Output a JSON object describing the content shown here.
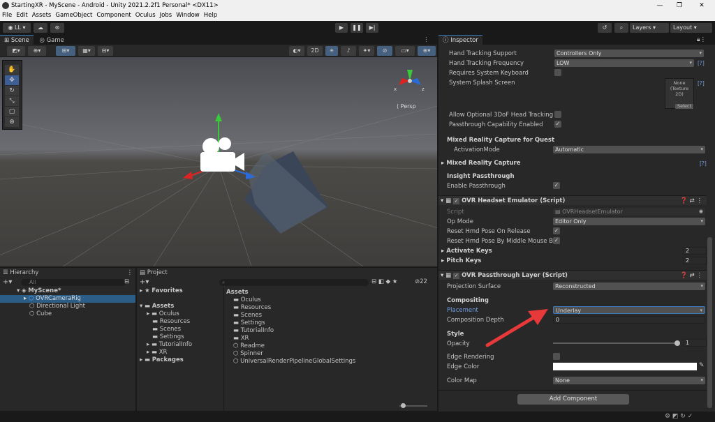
{
  "window": {
    "title": "StartingXR - MyScene - Android - Unity 2021.2.2f1 Personal* <DX11>"
  },
  "menu": [
    "File",
    "Edit",
    "Assets",
    "GameObject",
    "Component",
    "Oculus",
    "Jobs",
    "Window",
    "Help"
  ],
  "toolbar": {
    "account": "LL",
    "layers": "Layers",
    "layout": "Layout"
  },
  "scene_tabs": {
    "scene": "Scene",
    "game": "Game",
    "mode_2d": "2D",
    "persp": "Persp"
  },
  "gizmo": {
    "x": "x",
    "z": "z"
  },
  "hierarchy": {
    "title": "Hierarchy",
    "search_placeholder": "All",
    "scene": "MyScene*",
    "items": [
      "OVRCameraRig",
      "Directional Light",
      "Cube"
    ]
  },
  "project": {
    "title": "Project",
    "favorites": "Favorites",
    "assets": "Assets",
    "tree": [
      "Oculus",
      "Resources",
      "Scenes",
      "Settings",
      "TutorialInfo",
      "XR"
    ],
    "packages": "Packages",
    "content_title": "Assets",
    "count": "22",
    "content": [
      "Oculus",
      "Resources",
      "Scenes",
      "Settings",
      "TutorialInfo",
      "XR",
      "Readme",
      "Spinner",
      "UniversalRenderPipelineGlobalSettings"
    ]
  },
  "inspector": {
    "title": "Inspector",
    "top_rows": {
      "hand_tracking_support": {
        "label": "Hand Tracking Support",
        "value": "Controllers Only"
      },
      "hand_tracking_frequency": {
        "label": "Hand Tracking Frequency",
        "value": "LOW"
      },
      "requires_keyboard": {
        "label": "Requires System Keyboard"
      },
      "splash": {
        "label": "System Splash Screen",
        "none": "None",
        "type": "(Texture 2D)",
        "select": "Select"
      },
      "allow_3dof": {
        "label": "Allow Optional 3DoF Head Tracking"
      },
      "passthrough_cap": {
        "label": "Passthrough Capability Enabled"
      },
      "help": "[?]"
    },
    "mrc_quest": {
      "title": "Mixed Reality Capture for Quest",
      "activation_label": "ActivationMode",
      "activation_value": "Automatic"
    },
    "mrc": {
      "title": "Mixed Reality Capture"
    },
    "insight": {
      "title": "Insight Passthrough",
      "enable_label": "Enable Passthrough"
    },
    "headset_emulator": {
      "title": "OVR Headset Emulator (Script)",
      "script_label": "Script",
      "script_value": "OVRHeadsetEmulator",
      "opmode_label": "Op Mode",
      "opmode_value": "Editor Only",
      "reset_release": "Reset Hmd Pose On Release",
      "reset_middle": "Reset Hmd Pose By Middle Mouse Bu",
      "activate_keys": "Activate Keys",
      "activate_value": "2",
      "pitch_keys": "Pitch Keys",
      "pitch_value": "2"
    },
    "passthrough_layer": {
      "title": "OVR Passthrough Layer (Script)",
      "proj_surface_label": "Projection Surface",
      "proj_surface_value": "Reconstructed",
      "compositing": "Compositing",
      "placement_label": "Placement",
      "placement_value": "Underlay",
      "depth_label": "Composition Depth",
      "depth_value": "0",
      "style": "Style",
      "opacity_label": "Opacity",
      "opacity_value": "1",
      "edge_rendering_label": "Edge Rendering",
      "edge_color_label": "Edge Color",
      "color_map_label": "Color Map",
      "color_map_value": "None"
    },
    "add_component": "Add Component"
  },
  "colors": {
    "accent": "#3a79bb",
    "arrow": "#e8393a",
    "placement_link": "#6fa0e6"
  }
}
